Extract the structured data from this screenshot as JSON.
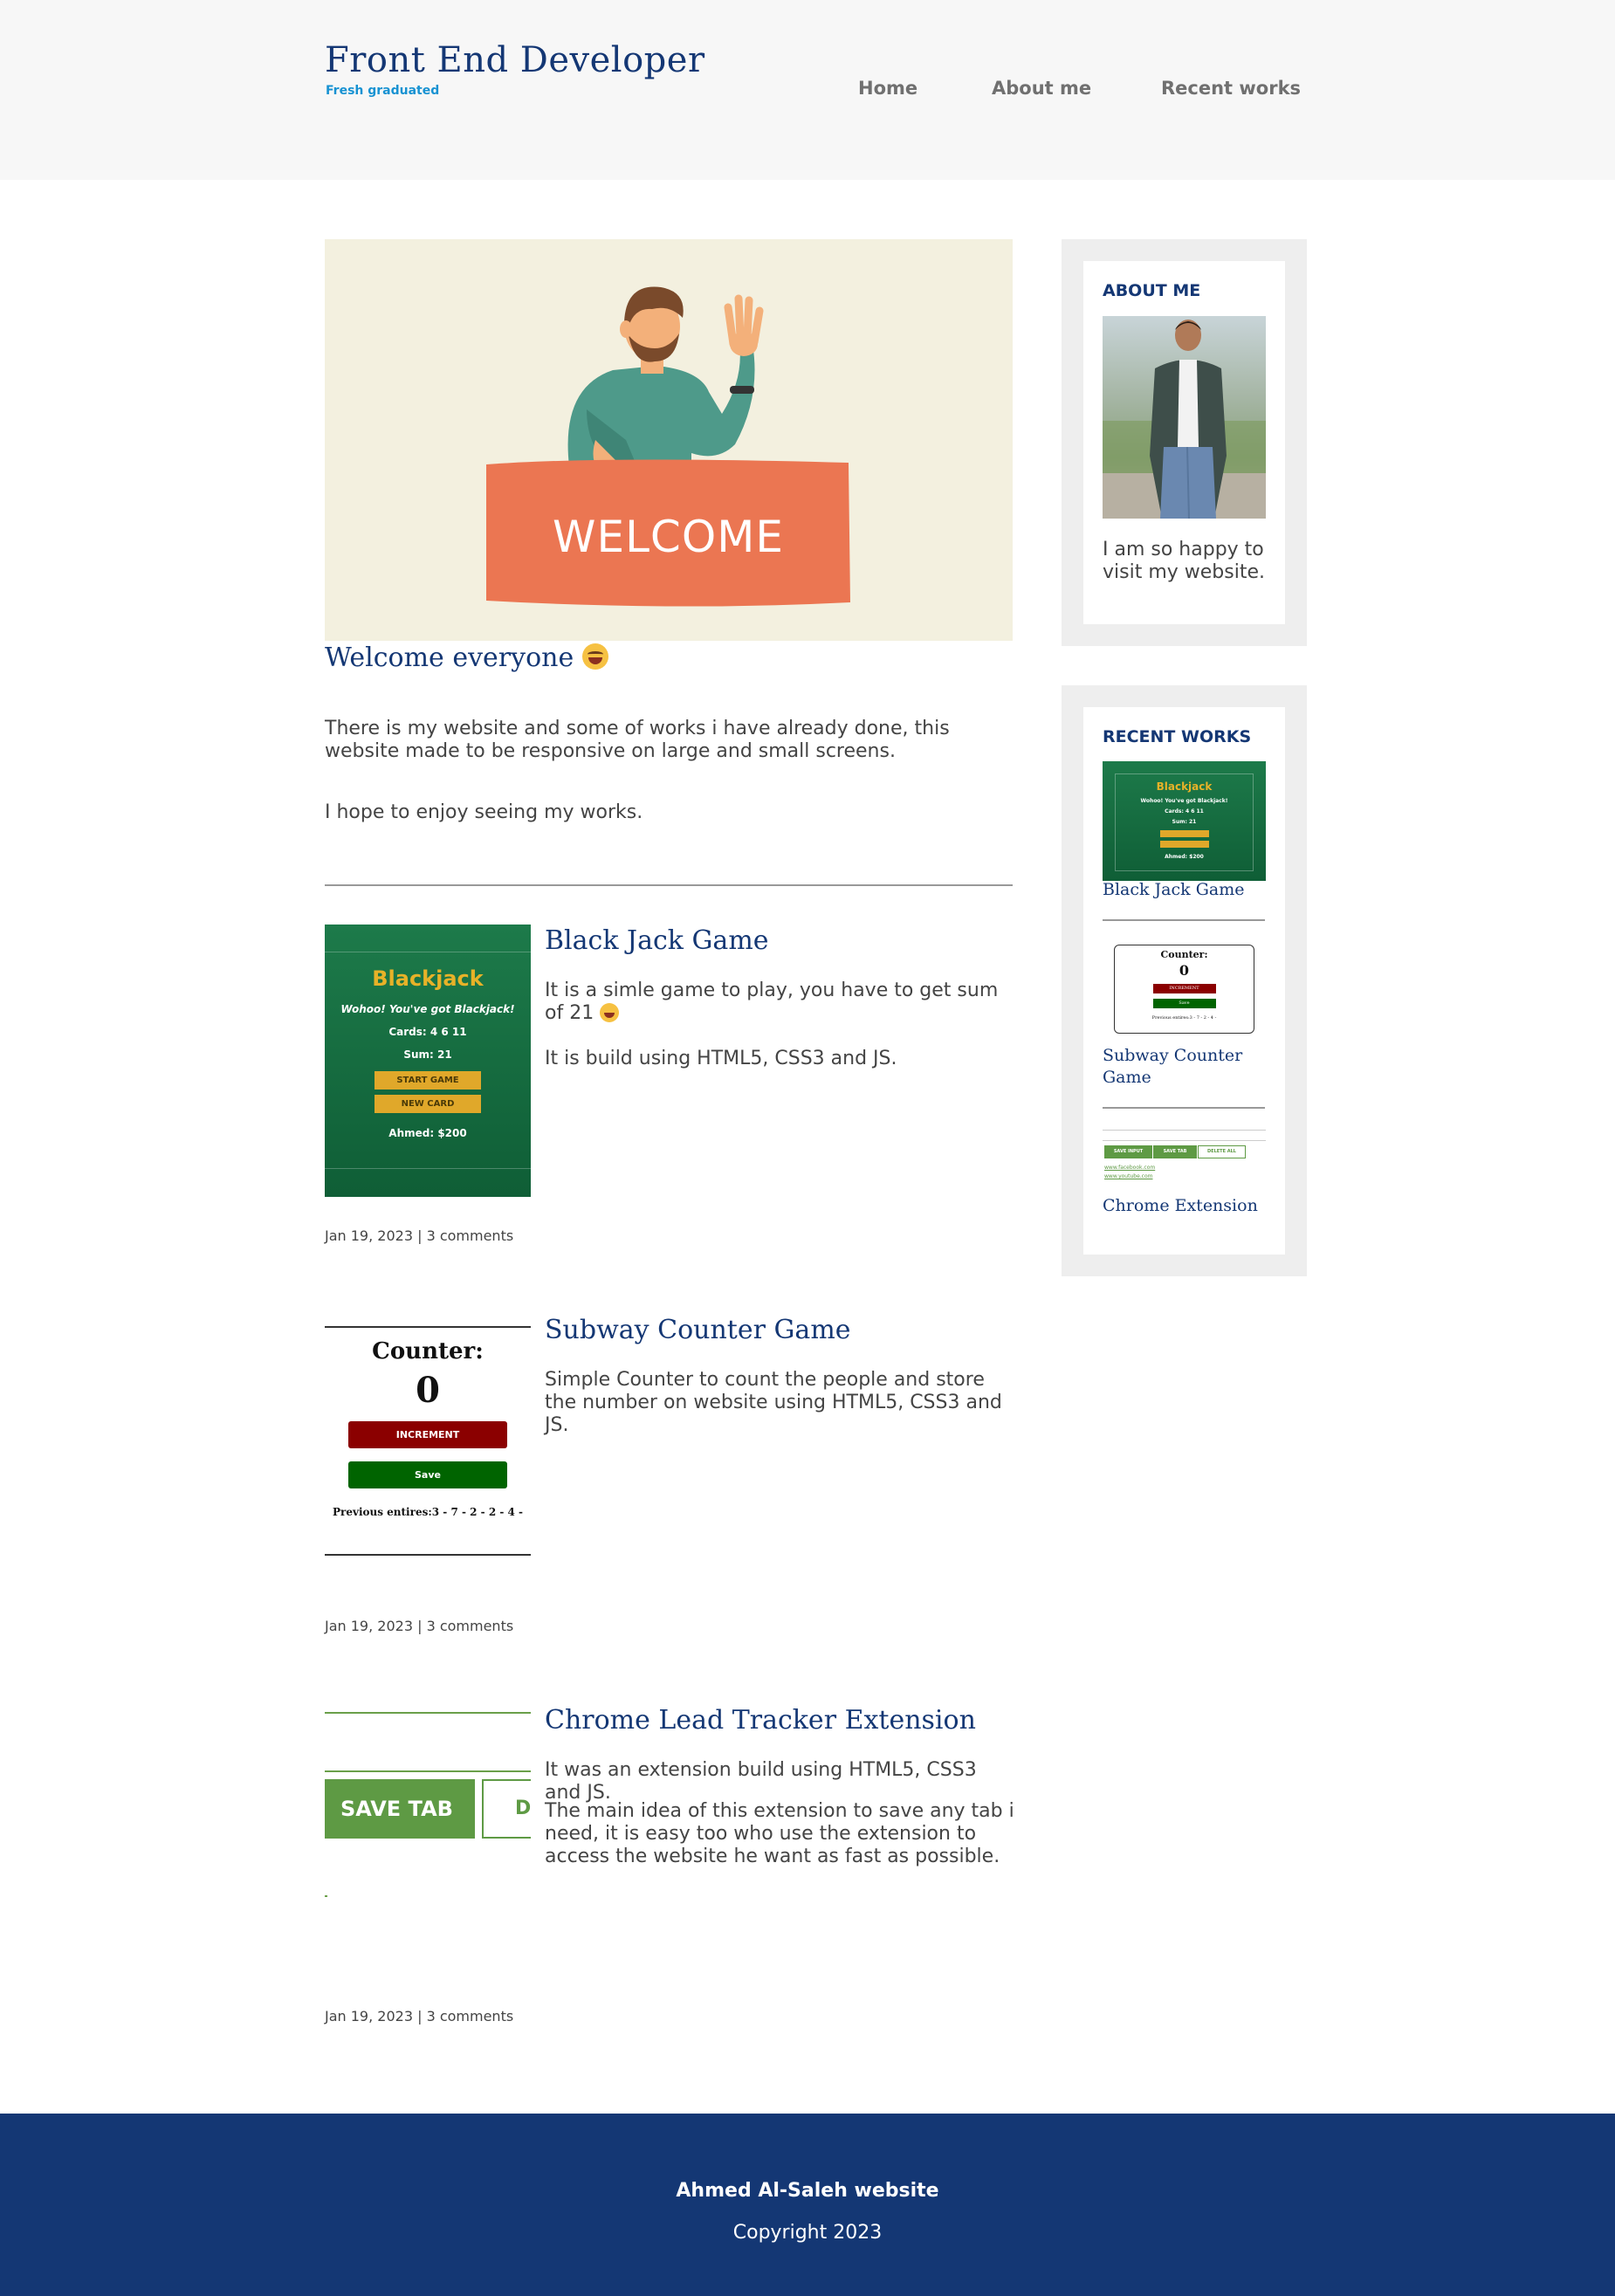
{
  "header": {
    "title": "Front End Developer",
    "subtitle": "Fresh graduated",
    "nav": [
      "Home",
      "About me",
      "Recent works"
    ]
  },
  "hero": {
    "banner_text": "WELCOME",
    "heading": "Welcome everyone",
    "paragraphs": [
      "There is my website and some of works i have already done, this website made to be responsive on large and small screens.",
      "I hope to enjoy seeing my works."
    ]
  },
  "articles": [
    {
      "title": "Black Jack Game",
      "paragraphs": [
        "It is a simle game to play, you have to get sum of 21",
        "It is build using HTML5, CSS3 and JS."
      ],
      "date": "Jan 19, 2023",
      "comments": "3 comments",
      "thumb": {
        "title": "Blackjack",
        "message": "Wohoo! You've got Blackjack!",
        "cards": "Cards: 4 6 11",
        "sum": "Sum: 21",
        "start_button": "START GAME",
        "new_card_button": "NEW CARD",
        "player": "Ahmed: $200"
      }
    },
    {
      "title": "Subway Counter Game",
      "paragraphs": [
        "Simple Counter to count the people and store the number on website using HTML5, CSS3 and JS."
      ],
      "date": "Jan 19, 2023",
      "comments": "3 comments",
      "thumb": {
        "heading": "Counter:",
        "count": "0",
        "increment_button": "INCREMENT",
        "save_button": "Save",
        "previous": "Previous entires:3 - 7 - 2 - 2 - 4 -"
      }
    },
    {
      "title": "Chrome Lead Tracker Extension",
      "paragraphs": [
        "It was an extension build using HTML5, CSS3 and JS.",
        "The main idea of this extension to save any tab i need, it is easy too who use the extension to access the website he want as fast as possible."
      ],
      "date": "Jan 19, 2023",
      "comments": "3 comments",
      "thumb": {
        "save_tab_button": "SAVE TAB",
        "delete_partial": "D"
      }
    }
  ],
  "sidebar": {
    "about": {
      "heading": "ABOUT ME",
      "text": "I am so happy to visit my website."
    },
    "recent": {
      "heading": "RECENT WORKS",
      "items": [
        "Black Jack Game",
        "Subway Counter Game",
        "Chrome Extension"
      ],
      "mini": {
        "bj_title": "Blackjack",
        "bj_message": "Wohoo! You've got Blackjack!",
        "bj_cards": "Cards: 4 6 11",
        "bj_sum": "Sum: 21",
        "bj_player": "Ahmed: $200",
        "ctr_heading": "Counter:",
        "ctr_count": "0",
        "ctr_increment": "INCREMENT",
        "ctr_save": "Save",
        "ctr_previous": "Previous entires:3 - 7 - 2 - 4 -",
        "ext_save_input": "SAVE INPUT",
        "ext_save_tab": "SAVE TAB",
        "ext_delete_all": "DELETE ALL",
        "ext_link1": "www.facebook.com",
        "ext_link2": "www.youtube.com"
      }
    }
  },
  "footer": {
    "name": "Ahmed Al-Saleh website",
    "copyright": "Copyright 2023"
  },
  "colors": {
    "navy": "#143774",
    "accent_blue": "#1792d2",
    "hero_bg": "#f3f0df",
    "banner": "#eb7652",
    "sidebar_bg": "#eeeeee"
  }
}
